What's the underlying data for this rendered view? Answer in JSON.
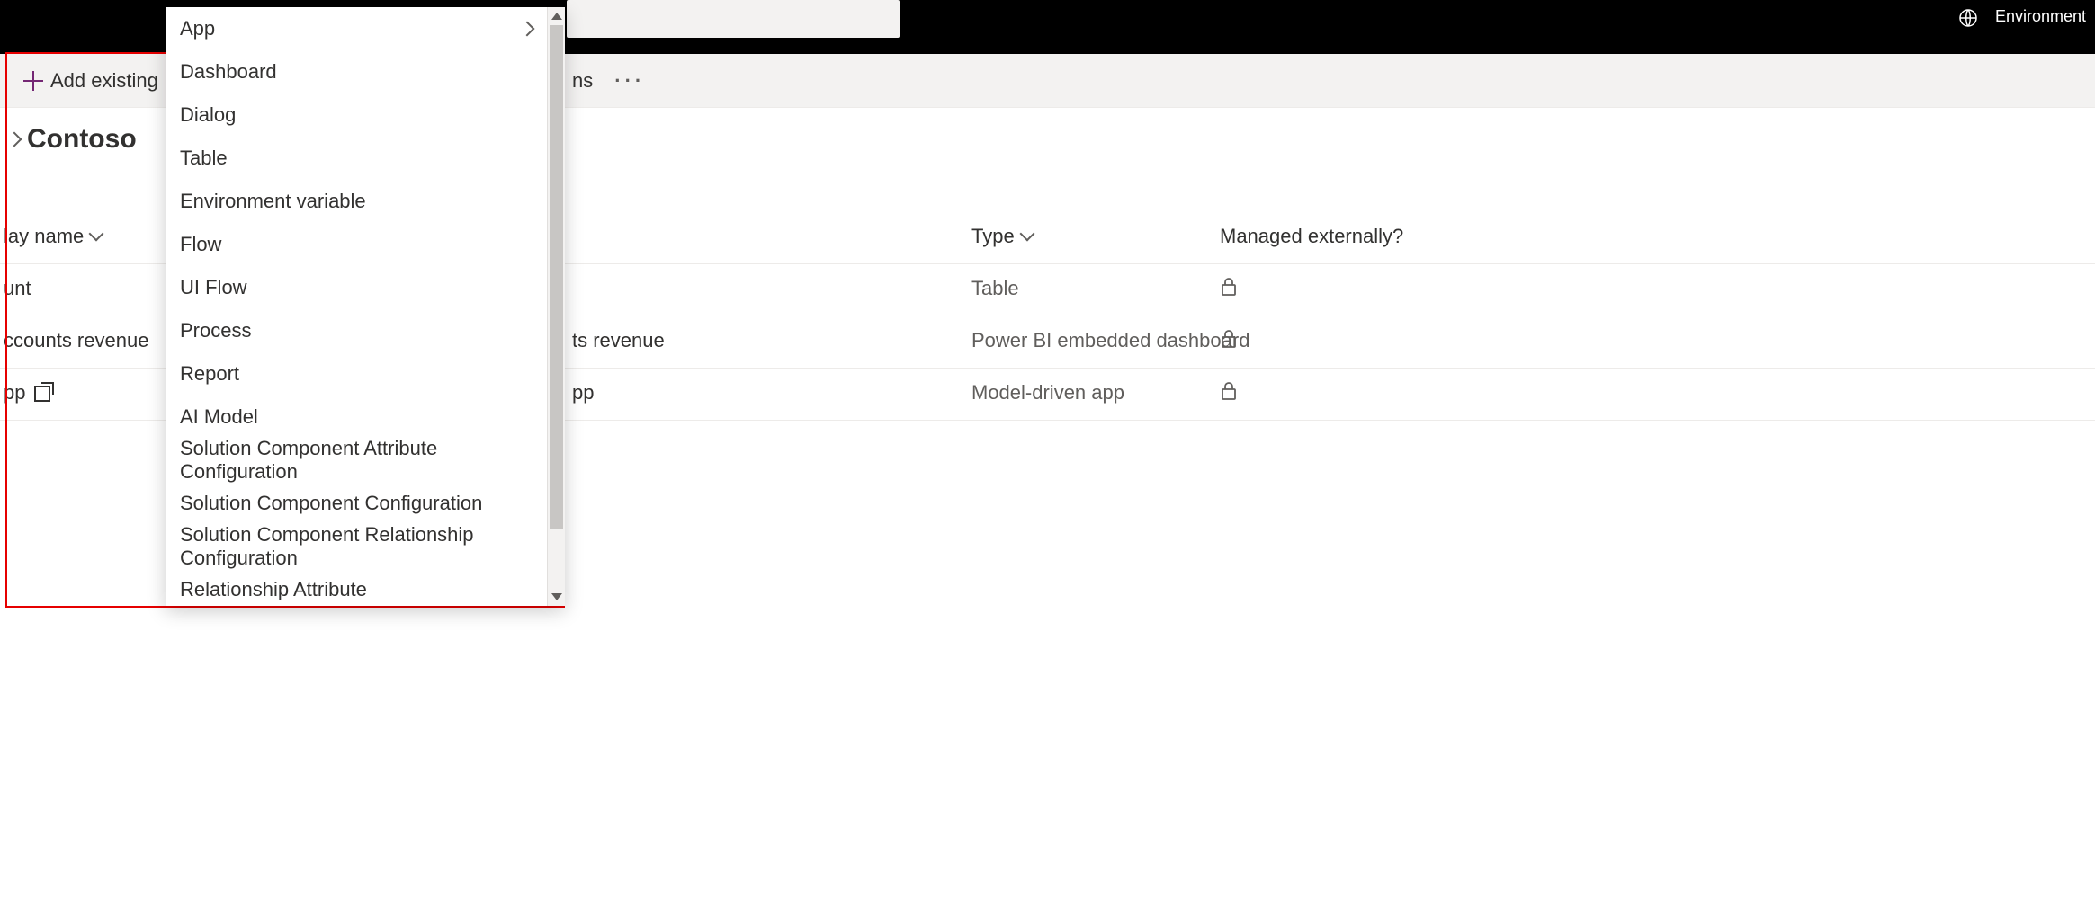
{
  "topbar": {
    "environment_label": "Environment"
  },
  "commandbar": {
    "add_existing_label": "Add existing",
    "tail_text_fragment": "ns"
  },
  "page": {
    "title": "Contoso"
  },
  "columns": {
    "display_name_fragment": "lay name",
    "type_label": "Type",
    "managed_externally_label": "Managed externally?"
  },
  "rows": [
    {
      "display_name_fragment": "unt",
      "name_fragment": "",
      "type": "Table",
      "managed_externally": "locked"
    },
    {
      "display_name_fragment": "ccounts revenue",
      "name_fragment": "ts revenue",
      "type": "Power BI embedded dashboard",
      "managed_externally": "locked"
    },
    {
      "display_name_fragment": "pp",
      "has_external_link": true,
      "name_fragment": "pp",
      "type": "Model-driven app",
      "managed_externally": "locked"
    }
  ],
  "dropdown": {
    "items": [
      {
        "label": "App",
        "has_submenu": true
      },
      {
        "label": "Dashboard"
      },
      {
        "label": "Dialog"
      },
      {
        "label": "Table"
      },
      {
        "label": "Environment variable"
      },
      {
        "label": "Flow"
      },
      {
        "label": "UI Flow"
      },
      {
        "label": "Process"
      },
      {
        "label": "Report"
      },
      {
        "label": "AI Model"
      },
      {
        "label": "Solution Component Attribute Configuration"
      },
      {
        "label": "Solution Component Configuration"
      },
      {
        "label": "Solution Component Relationship Configuration"
      },
      {
        "label": "Relationship Attribute"
      }
    ]
  }
}
